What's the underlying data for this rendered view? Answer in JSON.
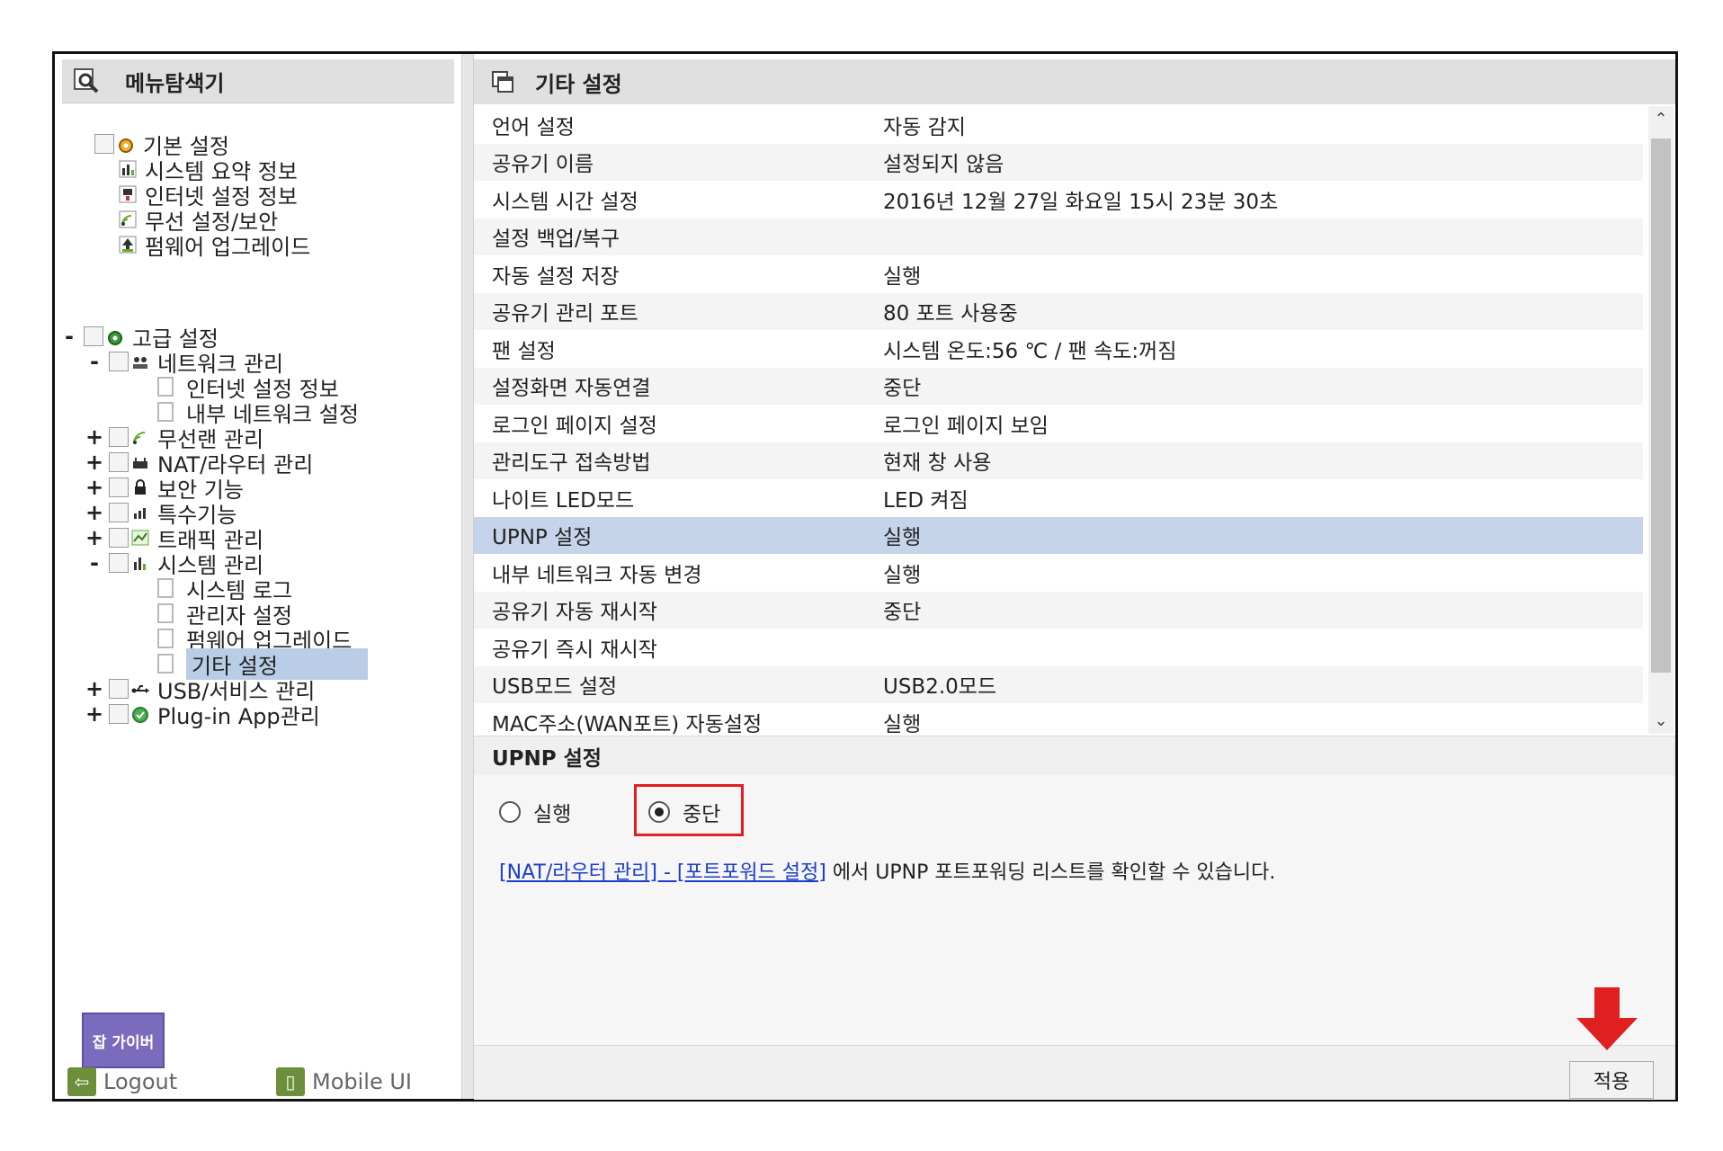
{
  "sidebar": {
    "title": "메뉴탐색기",
    "basic": {
      "label": "기본 설정",
      "items": [
        "시스템 요약 정보",
        "인터넷 설정 정보",
        "무선 설정/보안",
        "펌웨어 업그레이드"
      ]
    },
    "advanced": {
      "toggle": "-",
      "label": "고급 설정",
      "groups": [
        {
          "toggle": "-",
          "label": "네트워크 관리",
          "children": [
            "인터넷 설정 정보",
            "내부 네트워크 설정"
          ]
        },
        {
          "toggle": "+",
          "label": "무선랜 관리"
        },
        {
          "toggle": "+",
          "label": "NAT/라우터 관리"
        },
        {
          "toggle": "+",
          "label": "보안 기능"
        },
        {
          "toggle": "+",
          "label": "특수기능"
        },
        {
          "toggle": "+",
          "label": "트래픽 관리"
        },
        {
          "toggle": "-",
          "label": "시스템 관리",
          "children": [
            "시스템 로그",
            "관리자 설정",
            "펌웨어 업그레이드",
            "기타 설정"
          ]
        },
        {
          "toggle": "+",
          "label": "USB/서비스 관리"
        },
        {
          "toggle": "+",
          "label": "Plug-in App관리"
        }
      ]
    },
    "logo_text": "잡 가이버",
    "logout_label": "Logout",
    "mobile_label": "Mobile UI"
  },
  "main": {
    "title": "기타 설정",
    "rows": [
      {
        "k": "언어 설정",
        "v": "자동 감지"
      },
      {
        "k": "공유기 이름",
        "v": "설정되지 않음"
      },
      {
        "k": "시스템 시간 설정",
        "v": "2016년 12월 27일 화요일 15시 23분 30초"
      },
      {
        "k": "설정 백업/복구",
        "v": ""
      },
      {
        "k": "자동 설정 저장",
        "v": "실행"
      },
      {
        "k": "공유기 관리 포트",
        "v": "80 포트 사용중"
      },
      {
        "k": "팬 설정",
        "v": "시스템 온도:56 ℃ / 팬 속도:꺼짐"
      },
      {
        "k": "설정화면 자동연결",
        "v": "중단"
      },
      {
        "k": "로그인 페이지 설정",
        "v": "로그인 페이지 보임"
      },
      {
        "k": "관리도구 접속방법",
        "v": "현재 창 사용"
      },
      {
        "k": "나이트 LED모드",
        "v": "LED 켜짐"
      },
      {
        "k": "UPNP 설정",
        "v": "실행"
      },
      {
        "k": "내부 네트워크 자동 변경",
        "v": "실행"
      },
      {
        "k": "공유기 자동 재시작",
        "v": "중단"
      },
      {
        "k": "공유기 즉시 재시작",
        "v": ""
      },
      {
        "k": "USB모드 설정",
        "v": "USB2.0모드"
      },
      {
        "k": "MAC주소(WAN포트) 자동설정",
        "v": "실행"
      }
    ],
    "selected_row": "UPNP 설정",
    "detail": {
      "title": "UPNP 설정",
      "option_run": "실행",
      "option_stop": "중단",
      "selected": "중단",
      "link_text": "[NAT/라우터 관리] - [포트포워드 설정]",
      "note_text": " 에서 UPNP 포트포워딩 리스트를 확인할 수 있습니다."
    },
    "apply_label": "적용"
  },
  "colors": {
    "selection": "#c5d4ea",
    "highlight_box": "#e02020",
    "arrow": "#e02020",
    "link": "#1a3cc8"
  }
}
